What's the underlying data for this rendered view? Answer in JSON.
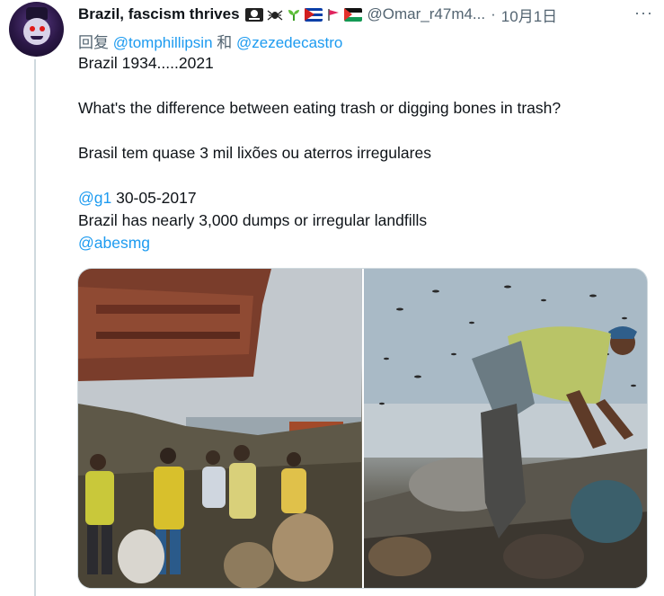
{
  "tweet": {
    "display_name": "Brazil, fascism thrives",
    "badges": [
      "pirate-flag-icon",
      "spider-icon",
      "seedling-icon",
      "cuba-flag-icon",
      "red-flag-icon",
      "palestine-flag-icon"
    ],
    "handle": "@Omar_r47m4...",
    "separator": "·",
    "date": "10月1日",
    "more": "···",
    "reply_prefix": "回复",
    "reply_user_1": "@tomphillipsin",
    "reply_conjunction": "和",
    "reply_user_2": "@zezedecastro",
    "lines": {
      "l1": "Brazil 1934.....2021",
      "l2": "What's the difference between eating trash or digging bones in trash?",
      "l3": "Brasil tem quase 3 mil lixões ou aterros irregulares",
      "l4_mention": "@g1",
      "l4_text": " 30-05-2017",
      "l5": "Brazil has nearly 3,000 dumps or irregular landfills",
      "l6_mention": "@abesmg"
    }
  },
  "colors": {
    "accent": "#1d9bf0",
    "secondary_text": "#536471",
    "thread_line": "#cfd9de"
  }
}
